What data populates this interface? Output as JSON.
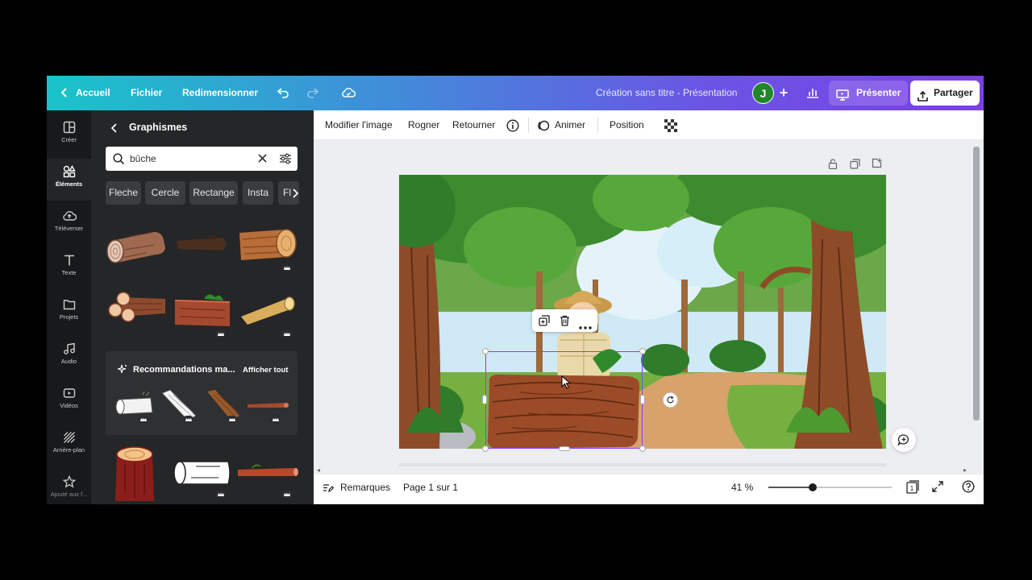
{
  "topbar": {
    "home_label": "Accueil",
    "file_label": "Fichier",
    "resize_label": "Redimensionner",
    "doc_title": "Création sans titre - Présentation",
    "avatar_initial": "J",
    "present_label": "Présenter",
    "share_label": "Partager"
  },
  "rail": {
    "items": [
      {
        "label": "Créer",
        "icon": "layout-icon"
      },
      {
        "label": "Éléments",
        "icon": "elements-icon"
      },
      {
        "label": "Téléverser",
        "icon": "upload-icon"
      },
      {
        "label": "Texte",
        "icon": "text-icon"
      },
      {
        "label": "Projets",
        "icon": "folder-icon"
      },
      {
        "label": "Audio",
        "icon": "music-icon"
      },
      {
        "label": "Vidéos",
        "icon": "video-icon"
      },
      {
        "label": "Arrière-plan",
        "icon": "background-icon"
      },
      {
        "label": "Ajouté aux f...",
        "icon": "star-icon"
      }
    ]
  },
  "panel": {
    "title": "Graphismes",
    "search_value": "bûche",
    "chips": [
      "Fleche",
      "Cercle",
      "Rectange",
      "Insta",
      "Fl"
    ],
    "reco_title": "Recommandations ma...",
    "reco_all": "Afficher tout"
  },
  "context_toolbar": {
    "edit_image": "Modifier l'image",
    "crop": "Rogner",
    "flip": "Retourner",
    "animate": "Animer",
    "position": "Position"
  },
  "bottombar": {
    "notes": "Remarques",
    "page": "Page 1 sur 1",
    "zoom": "41 %",
    "zoom_fraction": 0.36
  },
  "colors": {
    "accent": "#8b3dff",
    "panel_bg": "#252627",
    "rail_bg": "#18191b",
    "log_brown": "#8e4a2e"
  }
}
